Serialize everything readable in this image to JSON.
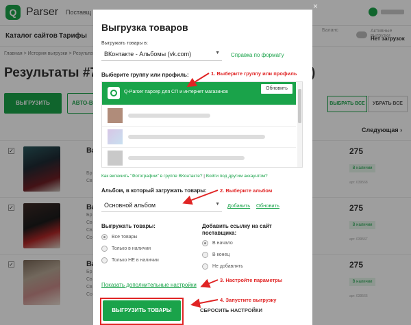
{
  "app": {
    "logo_letter": "Q",
    "name": "Parser",
    "top_nav": "Поставщ",
    "sub_nav": [
      "Каталог сайтов",
      "Тарифы"
    ],
    "balance_label": "Баланс",
    "autoload_title": "Активные выгрузки",
    "autoload_value": "Нет загрузок"
  },
  "page": {
    "breadcrumbs": "Главная  >  История выгрузки  >  Результаты В",
    "title": "Результаты #73",
    "title_tail": ")",
    "export_label": "ВЫГРУЗИТЬ",
    "auto_label": "АВТО-В",
    "select_all_label": "ВЫБРАТЬ ВСЕ",
    "deselect_all_label": "УБРАТЬ ВСЕ",
    "next_label": "Следующая",
    "products": [
      {
        "title_start": "Ва",
        "price": "275",
        "stock": "В наличии",
        "sku": "арт. 039568",
        "line1": "Бр",
        "line2": "Св",
        "line3": "Св",
        "line4": "Со"
      },
      {
        "title_start": "Ва",
        "price": "275",
        "stock": "В наличии",
        "sku": "арт. 039567",
        "line1": "Бр",
        "line2": "Св",
        "line3": "Св",
        "line4": "Со"
      },
      {
        "title_start": "Ва",
        "price": "275",
        "stock": "В наличии",
        "sku": "арт. 039566",
        "line1": "Бр",
        "line2": "Св",
        "line3": "Св",
        "line4": "Со"
      }
    ]
  },
  "modal": {
    "close_glyph": "×",
    "title": "Выгрузка товаров",
    "export_to_label": "Выгружать товары в:",
    "export_to_value": "ВКонтакте - Альбомы (vk.com)",
    "format_help_link": "Справка по формату",
    "choose_group_label": "Выберите группу или профиль:",
    "selected_group": "Q-Parser парсер для СП и интернет магазинов",
    "refresh_label": "Обновить",
    "vk_hint_part1": "Как включить \"Фотографии\" в группе ВКонтакте?",
    "vk_hint_sep": " | ",
    "vk_hint_part2": "Войти под другим аккаунтом?",
    "album_label": "Альбом, в который загружать товары:",
    "album_value": "Основной альбом",
    "album_add_link": "Добавить",
    "album_refresh_link": "Обновить",
    "export_goods_label": "Выгружать товары:",
    "export_goods_options": [
      "Все товары",
      "Только в наличии",
      "Только НЕ в наличии"
    ],
    "supplier_link_label_1": "Добавить ссылку на сайт",
    "supplier_link_label_2": "поставщика:",
    "supplier_link_options": [
      "В начало",
      "В конец",
      "Не добавлять"
    ],
    "more_settings_link": "Показать дополнительные настройки",
    "export_button": "ВЫГРУЗИТЬ ТОВАРЫ",
    "reset_button": "СБРОСИТЬ НАСТРОЙКИ"
  },
  "annotations": {
    "step1": "1. Выберите группу или профиль",
    "step2": "2. Выберите альбом",
    "step3": "3. Настройте параметры",
    "step4": "4. Запустите выгрузку",
    "color": "#e02424"
  },
  "colors": {
    "accent": "#1aa34a",
    "annotation": "#e02424"
  }
}
